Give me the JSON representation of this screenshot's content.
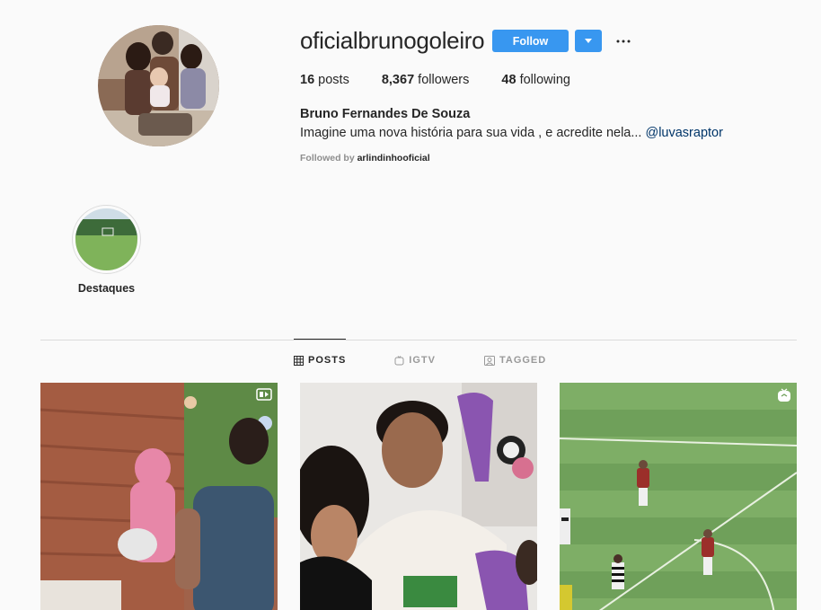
{
  "profile": {
    "username": "oficialbrunogoleiro",
    "follow_label": "Follow",
    "more_label": "···",
    "stats": {
      "posts_count": "16",
      "posts_label": "posts",
      "followers_count": "8,367",
      "followers_label": "followers",
      "following_count": "48",
      "following_label": "following"
    },
    "full_name": "Bruno Fernandes De Souza",
    "bio_text": "Imagine uma nova história para sua vida , e acredite nela...",
    "bio_mention": "@luvasraptor",
    "followed_by_prefix": "Followed by",
    "followed_by_user": "arlindinhooficial"
  },
  "highlights": [
    {
      "label": "Destaques"
    }
  ],
  "tabs": [
    {
      "label": "POSTS",
      "icon": "grid-icon",
      "active": true
    },
    {
      "label": "IGTV",
      "icon": "igtv-icon",
      "active": false
    },
    {
      "label": "TAGGED",
      "icon": "tagged-icon",
      "active": false
    }
  ],
  "posts": [
    {
      "badge": "video-icon"
    },
    {
      "badge": ""
    },
    {
      "badge": "igtv-icon"
    }
  ],
  "colors": {
    "accent": "#3897f0",
    "mention": "#003569",
    "background": "#fafafa"
  }
}
